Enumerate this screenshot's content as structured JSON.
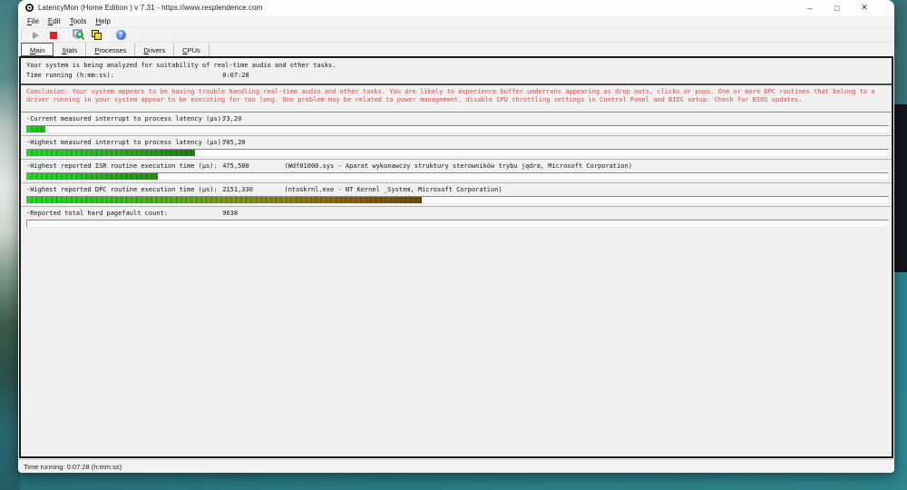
{
  "window": {
    "title": "LatencyMon  (Home Edition )  v 7.31 - https://www.resplendence.com",
    "controls": {
      "minimize": "–",
      "maximize": "□",
      "close": "✕"
    }
  },
  "menu": {
    "items": [
      "File",
      "Edit",
      "Tools",
      "Help"
    ]
  },
  "toolbar": {
    "icons": [
      "start-monitor",
      "stop-monitor",
      "analyze",
      "copy-report",
      "help"
    ]
  },
  "tabs": [
    {
      "label": "Main",
      "active": true
    },
    {
      "label": "Stats",
      "active": false
    },
    {
      "label": "Processes",
      "active": false
    },
    {
      "label": "Drivers",
      "active": false
    },
    {
      "label": "CPUs",
      "active": false
    }
  ],
  "main": {
    "status_line": "Your system is being analyzed for suitability of real-time audio and other tasks.",
    "time_label": "Time running (h:mm:ss):",
    "time_value": "0:07:28",
    "conclusion": "Conclusion: Your system appears to be having trouble handling real-time audio and other tasks. You are likely to experience buffer underruns appearing as drop outs, clicks or pops. One or more DPC routines that belong to a driver running in your system appear to be executing for too long. One problem may be related to power management, disable CPU throttling settings in Control Panel and BIOS setup. Check for BIOS updates.",
    "rows": [
      {
        "label": "·Current measured interrupt to process latency (µs):",
        "value": "73,20",
        "extra": "",
        "bar_pct": 2.1,
        "bar_colors": [
          "#17dd17",
          "#0ec50e"
        ]
      },
      {
        "label": "·Highest measured interrupt to process latency (µs):",
        "value": "705,20",
        "extra": "",
        "bar_pct": 19.5,
        "bar_colors": [
          "#1edc1e",
          "#22cf22",
          "#2bb327",
          "#28991f",
          "#1f7d14"
        ]
      },
      {
        "label": "·Highest reported ISR routine execution time (µs):",
        "value": "475,580",
        "extra": "(Wdf01000.sys - Aparat wykonawczy struktury sterowników trybu jądra, Microsoft Corporation)",
        "bar_pct": 15.2,
        "bar_colors": [
          "#1edc1e",
          "#24cc22",
          "#2ba424",
          "#2d8f1c"
        ]
      },
      {
        "label": "·Highest reported DPC routine execution time (µs):",
        "value": "2151,330",
        "extra": "(ntoskrnl.exe - NT Kernel _System, Microsoft Corporation)",
        "bar_pct": 45.8,
        "bar_colors": [
          "#1edc1e",
          "#2cc61f",
          "#51b01a",
          "#7a9a14",
          "#8c7d10",
          "#8a5c0c",
          "#6e4a08"
        ]
      },
      {
        "label": "·Reported total hard pagefault count:",
        "value": "9638",
        "extra": "",
        "bar_pct": 0,
        "bar_colors": []
      }
    ]
  },
  "statusbar": {
    "text": "Time running: 0:07:28  (h:mm:ss)"
  },
  "colors": {
    "conclusion_red": "#e8463c",
    "bar_green": "#1edc1e",
    "bar_brown": "#6e4a08",
    "desktop_teal": "#2b7b83"
  }
}
